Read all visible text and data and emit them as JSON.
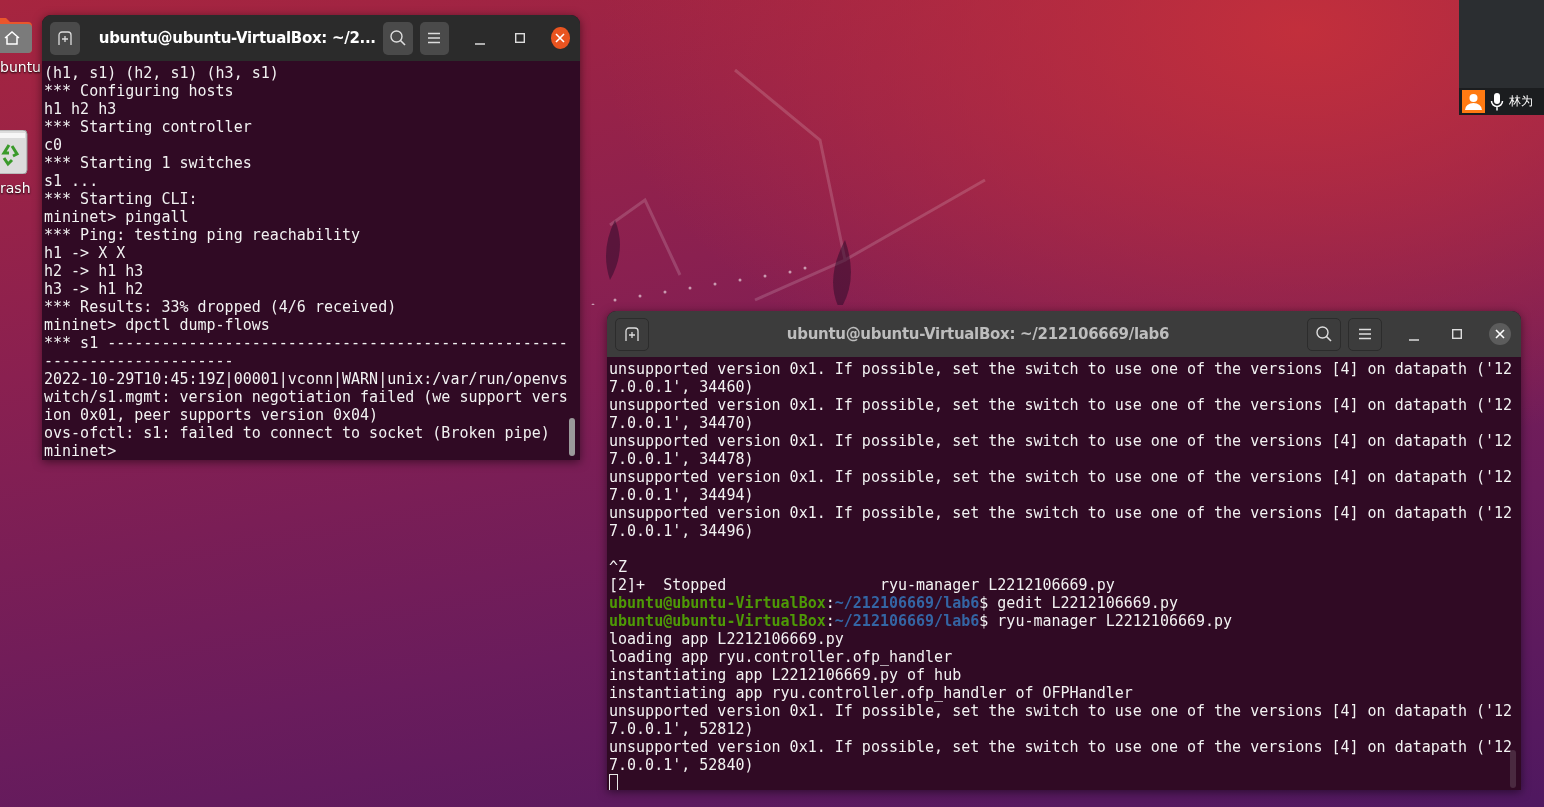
{
  "desktop_icons": [
    {
      "kind": "home",
      "label": "buntu"
    },
    {
      "kind": "trash",
      "label": "rash"
    }
  ],
  "terminals": [
    {
      "title": "ubuntu@ubuntu-VirtualBox: ~/2...",
      "focused": true,
      "lines": [
        {
          "kind": "output",
          "text": "(h1, s1) (h2, s1) (h3, s1)"
        },
        {
          "kind": "output",
          "text": "*** Configuring hosts"
        },
        {
          "kind": "output",
          "text": "h1 h2 h3"
        },
        {
          "kind": "output",
          "text": "*** Starting controller"
        },
        {
          "kind": "output",
          "text": "c0"
        },
        {
          "kind": "output",
          "text": "*** Starting 1 switches"
        },
        {
          "kind": "output",
          "text": "s1 ..."
        },
        {
          "kind": "output",
          "text": "*** Starting CLI:"
        },
        {
          "kind": "output",
          "text": "mininet> pingall"
        },
        {
          "kind": "output",
          "text": "*** Ping: testing ping reachability"
        },
        {
          "kind": "output",
          "text": "h1 -> X X"
        },
        {
          "kind": "output",
          "text": "h2 -> h1 h3"
        },
        {
          "kind": "output",
          "text": "h3 -> h1 h2"
        },
        {
          "kind": "output",
          "text": "*** Results: 33% dropped (4/6 received)"
        },
        {
          "kind": "output",
          "text": "mininet> dpctl dump-flows"
        },
        {
          "kind": "output",
          "text": "*** s1 ---------------------------------------------------"
        },
        {
          "kind": "output",
          "text": "---------------------"
        },
        {
          "kind": "output",
          "text": "2022-10-29T10:45:19Z|00001|vconn|WARN|unix:/var/run/openvs"
        },
        {
          "kind": "output",
          "text": "witch/s1.mgmt: version negotiation failed (we support vers"
        },
        {
          "kind": "output",
          "text": "ion 0x01, peer supports version 0x04)"
        },
        {
          "kind": "output",
          "text": "ovs-ofctl: s1: failed to connect to socket (Broken pipe)"
        },
        {
          "kind": "output",
          "text": "mininet>"
        }
      ]
    },
    {
      "title": "ubuntu@ubuntu-VirtualBox: ~/212106669/lab6",
      "focused": false,
      "lines": [
        {
          "kind": "output",
          "text": "unsupported version 0x1. If possible, set the switch to use one of the versions [4] on datapath ('12"
        },
        {
          "kind": "output",
          "text": "7.0.0.1', 34460)"
        },
        {
          "kind": "output",
          "text": "unsupported version 0x1. If possible, set the switch to use one of the versions [4] on datapath ('12"
        },
        {
          "kind": "output",
          "text": "7.0.0.1', 34470)"
        },
        {
          "kind": "output",
          "text": "unsupported version 0x1. If possible, set the switch to use one of the versions [4] on datapath ('12"
        },
        {
          "kind": "output",
          "text": "7.0.0.1', 34478)"
        },
        {
          "kind": "output",
          "text": "unsupported version 0x1. If possible, set the switch to use one of the versions [4] on datapath ('12"
        },
        {
          "kind": "output",
          "text": "7.0.0.1', 34494)"
        },
        {
          "kind": "output",
          "text": "unsupported version 0x1. If possible, set the switch to use one of the versions [4] on datapath ('12"
        },
        {
          "kind": "output",
          "text": "7.0.0.1', 34496)"
        },
        {
          "kind": "blank"
        },
        {
          "kind": "output",
          "text": "^Z"
        },
        {
          "kind": "output",
          "text": "[2]+  Stopped                 ryu-manager L2212106669.py"
        },
        {
          "kind": "prompt",
          "user": "ubuntu@ubuntu-VirtualBox",
          "sep": ":",
          "path": "~/212106669/lab6",
          "command": "$ gedit L2212106669.py"
        },
        {
          "kind": "prompt",
          "user": "ubuntu@ubuntu-VirtualBox",
          "sep": ":",
          "path": "~/212106669/lab6",
          "command": "$ ryu-manager L2212106669.py"
        },
        {
          "kind": "output",
          "text": "loading app L2212106669.py"
        },
        {
          "kind": "output",
          "text": "loading app ryu.controller.ofp_handler"
        },
        {
          "kind": "output",
          "text": "instantiating app L2212106669.py of hub"
        },
        {
          "kind": "output",
          "text": "instantiating app ryu.controller.ofp_handler of OFPHandler"
        },
        {
          "kind": "output",
          "text": "unsupported version 0x1. If possible, set the switch to use one of the versions [4] on datapath ('12"
        },
        {
          "kind": "output",
          "text": "7.0.0.1', 52812)"
        },
        {
          "kind": "output",
          "text": "unsupported version 0x1. If possible, set the switch to use one of the versions [4] on datapath ('12"
        },
        {
          "kind": "output",
          "text": "7.0.0.1', 52840)"
        },
        {
          "kind": "cursor"
        }
      ]
    }
  ],
  "call_panel": {
    "name": "林为"
  }
}
